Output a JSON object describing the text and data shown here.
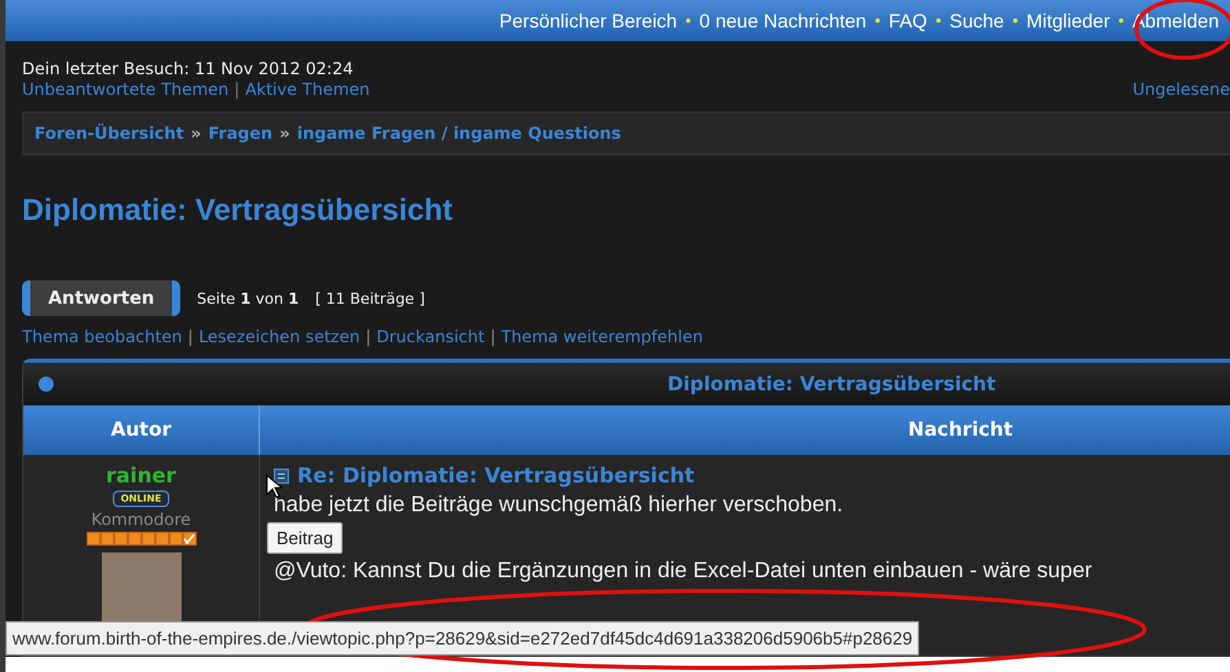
{
  "top_nav": {
    "links": [
      "Persönlicher Bereich",
      "0 neue Nachrichten",
      "FAQ",
      "Suche",
      "Mitglieder",
      "Abmelden"
    ],
    "separator": "•"
  },
  "last_visit": "Dein letzter Besuch: 11 Nov 2012 02:24",
  "quick_links": [
    "Unbeantwortete Themen",
    "Aktive Themen"
  ],
  "quick_links_right": "Ungelesene",
  "link_separator": "|",
  "breadcrumbs": {
    "items": [
      "Foren-Übersicht",
      "Fragen",
      "ingame Fragen / ingame Questions"
    ],
    "separator": "»"
  },
  "topic_title": "Diplomatie: Vertragsübersicht",
  "reply_button": "Antworten",
  "pagination": "Seite **1** von **1**",
  "post_count": "[ 11 Beiträge ]",
  "topic_tools": [
    "Thema beobachten",
    "Lesezeichen setzen",
    "Druckansicht",
    "Thema weiterempfehlen"
  ],
  "post_table": {
    "title": "Diplomatie: Vertragsübersicht",
    "columns": [
      "Autor",
      "Nachricht"
    ],
    "post": {
      "author": "rainer",
      "online_badge": "ONLINE",
      "rank": "Kommodore",
      "subject": "Re: Diplomatie: Vertragsübersicht",
      "lines": [
        "habe jetzt die Beiträge wunschgemäß hierher verschoben.",
        "@Vuto: Kannst Du die Ergänzungen in die Excel-Datei unten einbauen - wäre super"
      ]
    }
  },
  "tooltip": "Beitrag",
  "status_bar": "www.forum.birth-of-the-empires.de./viewtopic.php?p=28629&sid=e272ed7df45dc4d691a338206d5906b5#p28629"
}
